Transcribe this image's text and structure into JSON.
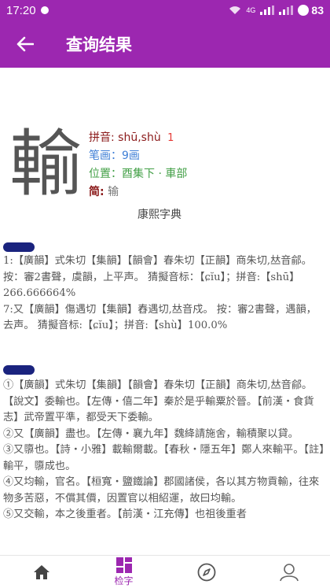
{
  "status_bar": {
    "time": "17:20",
    "network": "4G",
    "battery": "83"
  },
  "app_bar": {
    "title": "查询结果"
  },
  "character": {
    "glyph": "輸",
    "pinyin_label": "拼音:",
    "pinyin_value": "shū,shù",
    "pinyin_count": "1",
    "strokes": "笔画：9画",
    "radical": "位置：酉集下 · 車部",
    "simplified_label": "简:",
    "simplified_value": "输",
    "dictionary": "康熙字典"
  },
  "fanqie": {
    "line1": "1:【廣韻】式朱切【集韻】【韻會】春朱切【正韻】商朱切,𠀤音鄃。 按：審2書聲，虞韻，上平声。 猜擬音标：【ɕĭu】；拼音:【shū】266.666664%",
    "line2": "7:又【廣韻】傷遇切【集韻】舂遇切,𠀤音戍。 按：審2書聲，遇韻，去声。 猜擬音标:【ɕĭu】；拼音:【shù】100.0%"
  },
  "original": {
    "text1": "①【廣韻】式朱切【集韻】【韻會】春朱切【正韻】商朱切,𠀤音鄃。【說文】委輸也。【左傳・僖二年】秦於是乎輸粟於晉。【前漢・食貨志】武帝置平準，都受天下委輸。",
    "text2": "②又【廣韻】盡也。【左傳・襄九年】魏絳請施舍，輸積聚以貸。",
    "text3": "③又隳也。【詩・小雅】載輸爾載。【春秋・隱五年】鄭人來輸平。【註】輸平，隳成也。",
    "text4": "④又均輸，官名。【桓寬・鹽鐵論】郡國諸侯，各以其方物貢輸，往來物多苦惡，不償其價，因置官以相紹運，故曰均輸。",
    "text5": "⑤又交輸，本之後重者。【前漢・江充傳】也祖後重者"
  },
  "bottom_nav": {
    "home_label": "",
    "search_label": "检字",
    "discover_label": "",
    "profile_label": ""
  },
  "colors": {
    "primary": "#9c27b0",
    "section_tag": "#1a237e"
  }
}
